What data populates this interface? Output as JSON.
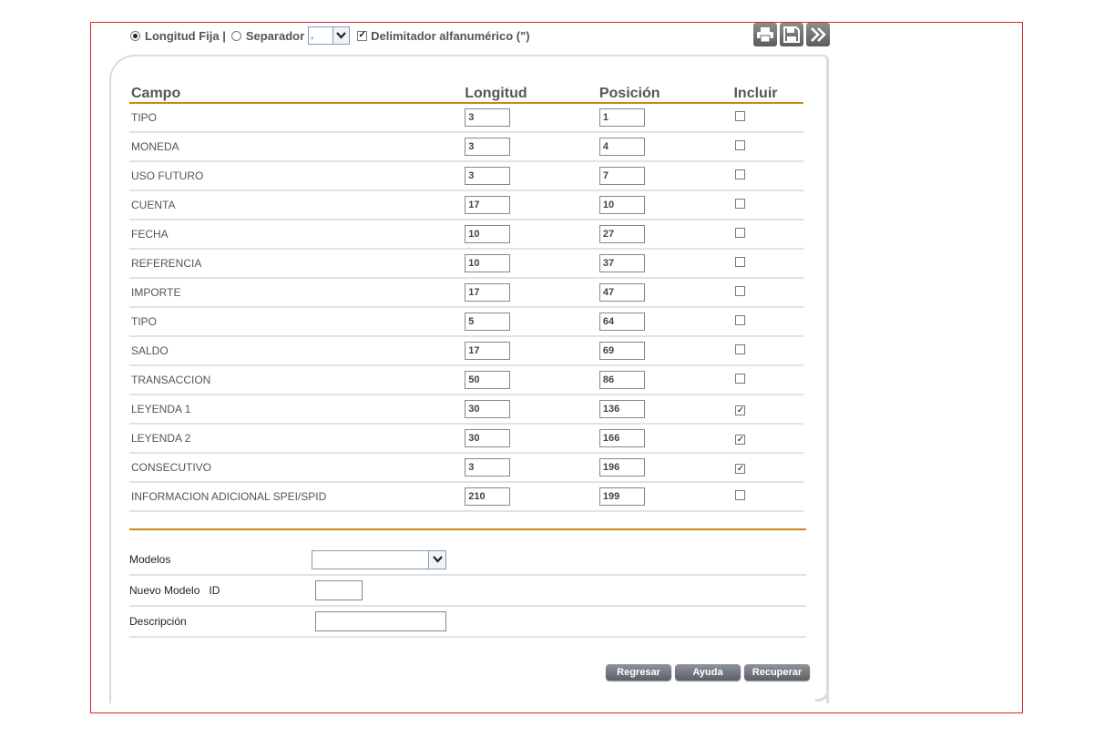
{
  "options": {
    "fixed_length_label": "Longitud Fija |",
    "separator_label": "Separador",
    "separator_value": ",",
    "delimiter_label": "Delimitador alfanumérico (\")"
  },
  "toolbar": {
    "print_icon": "printer-icon",
    "save_icon": "floppy-disk-icon",
    "next_icon": "double-chevron-right-icon"
  },
  "table": {
    "headers": {
      "campo": "Campo",
      "longitud": "Longitud",
      "posicion": "Posición",
      "incluir": "Incluir"
    },
    "rows": [
      {
        "campo": "TIPO",
        "longitud": "3",
        "posicion": "1",
        "incluir": false
      },
      {
        "campo": "MONEDA",
        "longitud": "3",
        "posicion": "4",
        "incluir": false
      },
      {
        "campo": "USO FUTURO",
        "longitud": "3",
        "posicion": "7",
        "incluir": false
      },
      {
        "campo": "CUENTA",
        "longitud": "17",
        "posicion": "10",
        "incluir": false
      },
      {
        "campo": "FECHA",
        "longitud": "10",
        "posicion": "27",
        "incluir": false
      },
      {
        "campo": "REFERENCIA",
        "longitud": "10",
        "posicion": "37",
        "incluir": false
      },
      {
        "campo": "IMPORTE",
        "longitud": "17",
        "posicion": "47",
        "incluir": false
      },
      {
        "campo": "TIPO",
        "longitud": "5",
        "posicion": "64",
        "incluir": false
      },
      {
        "campo": "SALDO",
        "longitud": "17",
        "posicion": "69",
        "incluir": false
      },
      {
        "campo": "TRANSACCION",
        "longitud": "50",
        "posicion": "86",
        "incluir": false
      },
      {
        "campo": "LEYENDA 1",
        "longitud": "30",
        "posicion": "136",
        "incluir": true
      },
      {
        "campo": "LEYENDA 2",
        "longitud": "30",
        "posicion": "166",
        "incluir": true
      },
      {
        "campo": "CONSECUTIVO",
        "longitud": "3",
        "posicion": "196",
        "incluir": true
      },
      {
        "campo": "INFORMACION ADICIONAL SPEI/SPID",
        "longitud": "210",
        "posicion": "199",
        "incluir": false
      }
    ]
  },
  "form": {
    "models_label": "Modelos",
    "models_value": "",
    "new_model_label": "Nuevo Modelo",
    "id_label": "ID",
    "id_value": "",
    "description_label": "Descripción",
    "description_value": ""
  },
  "buttons": {
    "back": "Regresar",
    "help": "Ayuda",
    "recover": "Recuperar"
  },
  "colors": {
    "frame": "#d9242b",
    "accent_rule": "#c98a1a",
    "button": "#6b7176"
  }
}
